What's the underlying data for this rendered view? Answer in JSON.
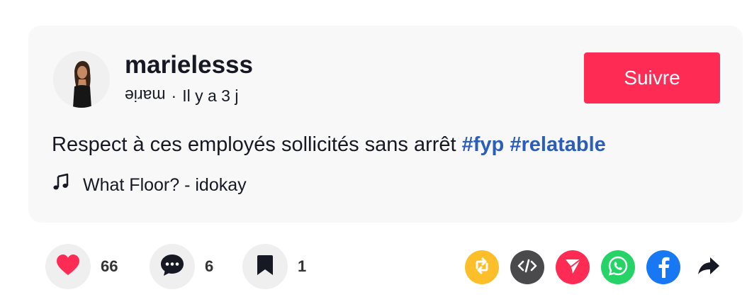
{
  "author": {
    "username": "marielesss",
    "nickname": "marie",
    "separator": "·",
    "time_ago": "Il y a 3 j"
  },
  "follow_label": "Suivre",
  "caption": {
    "text": "Respect à ces employés sollicités sans arrêt",
    "hashtags": [
      "#fyp",
      "#relatable"
    ]
  },
  "music": {
    "icon": "music-note-icon",
    "title": "What Floor? - idokay"
  },
  "stats": {
    "likes": "66",
    "comments": "6",
    "saves": "1"
  },
  "share_icons": [
    "repost-icon",
    "embed-icon",
    "send-icon",
    "whatsapp-icon",
    "facebook-icon",
    "share-arrow-icon"
  ],
  "colors": {
    "accent": "#fe2c55",
    "hashtag": "#2b5db9",
    "like": "#fe2c55",
    "repost": "#fcbf2a",
    "embed": "#4a4a4d",
    "send": "#fe2c55",
    "whatsapp": "#25d366",
    "facebook": "#1877f2"
  }
}
